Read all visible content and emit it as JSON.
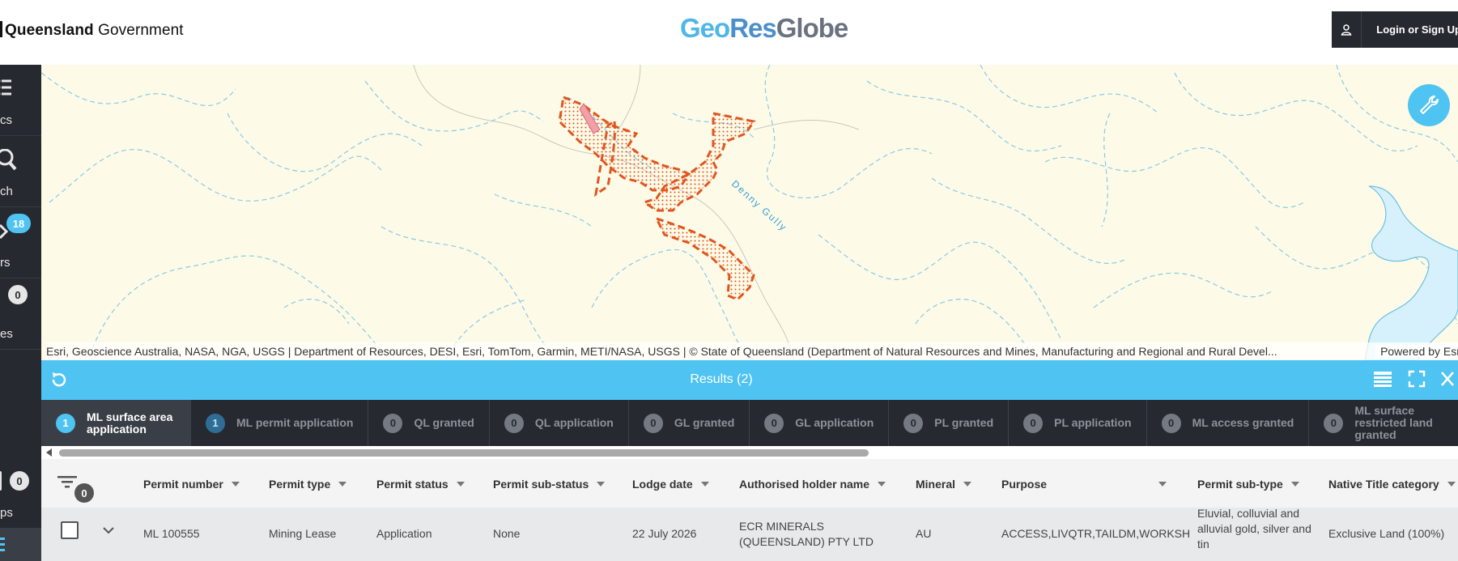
{
  "header": {
    "gov_bold": "Queensland",
    "gov_regular": "Government",
    "brand_geo": "Geo",
    "brand_res": "Res",
    "brand_globe": "Globe",
    "login_label": "Login or Sign Up"
  },
  "sidebar": {
    "items": [
      {
        "label": "cs",
        "icon": "layers-icon"
      },
      {
        "label": "ch",
        "icon": "search-icon"
      },
      {
        "label": "rs",
        "icon": "filters-icon",
        "badge": "18"
      },
      {
        "label": "es",
        "icon": "sites-icon",
        "badge": "0"
      },
      {
        "label": "ps",
        "icon": "apps-icon",
        "badge": "0"
      }
    ]
  },
  "map": {
    "stream_label": "Denny Gully",
    "attribution": "Esri, Geoscience Australia, NASA, NGA, USGS | Department of Resources, DESI, Esri, TomTom, Garmin, METI/NASA, USGS | © State of Queensland (Department of Natural Resources and Mines, Manufacturing and Regional and Rural Devel...",
    "powered": "Powered by Esri"
  },
  "results": {
    "title": "Results (2)"
  },
  "tabs": [
    {
      "count": "1",
      "label": "ML surface area application",
      "state": "on"
    },
    {
      "count": "1",
      "label": "ML permit application",
      "state": "dim"
    },
    {
      "count": "0",
      "label": "QL granted",
      "state": "off"
    },
    {
      "count": "0",
      "label": "QL application",
      "state": "off"
    },
    {
      "count": "0",
      "label": "GL granted",
      "state": "off"
    },
    {
      "count": "0",
      "label": "GL application",
      "state": "off"
    },
    {
      "count": "0",
      "label": "PL granted",
      "state": "off"
    },
    {
      "count": "0",
      "label": "PL application",
      "state": "off"
    },
    {
      "count": "0",
      "label": "ML access granted",
      "state": "off"
    },
    {
      "count": "0",
      "label": "ML surface restricted land granted",
      "state": "off"
    }
  ],
  "table": {
    "filter_count": "0",
    "columns": [
      "Permit number",
      "Permit type",
      "Permit status",
      "Permit sub-status",
      "Lodge date",
      "Authorised holder name",
      "Mineral",
      "Purpose",
      "Permit sub-type",
      "Native Title category"
    ],
    "rows": [
      {
        "permit_number": "ML 100555",
        "permit_type": "Mining Lease",
        "permit_status": "Application",
        "permit_sub_status": "None",
        "lodge_date": "22 July 2026",
        "holder": "ECR MINERALS (QUEENSLAND) PTY LTD",
        "mineral": "AU",
        "purpose": "ACCESS,LIVQTR,TAILDM,WORKSH",
        "sub_type": "Eluvial, colluvial and alluvial gold, silver and tin",
        "native_title": "Exclusive Land (100%)"
      }
    ]
  },
  "colors": {
    "accent": "#4fc3f1",
    "dark": "#262a30",
    "map_bg": "#fdfbe8",
    "permit_outline": "#e0561f"
  }
}
